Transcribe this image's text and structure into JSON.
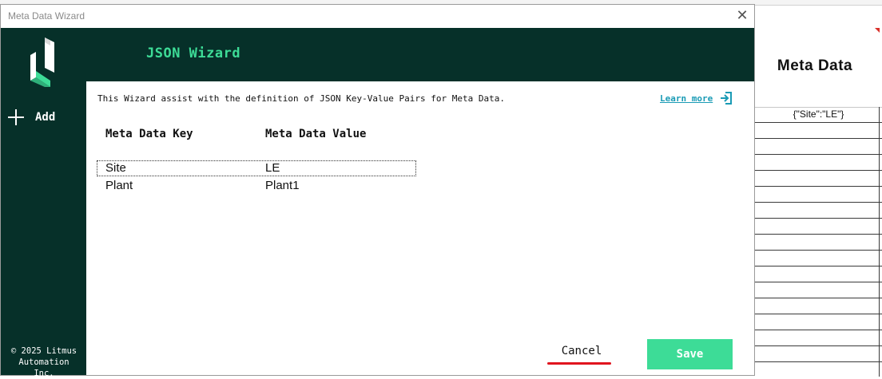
{
  "window": {
    "title": "Meta Data Wizard",
    "close_glyph": "✕"
  },
  "header": {
    "title": "JSON Wizard"
  },
  "sidebar": {
    "logo_icon": "litmus-logo-icon",
    "add_label": "Add",
    "copyright_line1": "© 2025 Litmus",
    "copyright_line2": "Automation Inc."
  },
  "content": {
    "info_text": "This Wizard assist with the definition of JSON Key-Value Pairs for Meta Data.",
    "learn_more": "Learn more",
    "columns": {
      "key": "Meta Data Key",
      "value": "Meta Data Value"
    },
    "rows": [
      {
        "key": "Site",
        "value": "LE",
        "selected": true
      },
      {
        "key": "Plant",
        "value": "Plant1",
        "selected": false
      }
    ]
  },
  "footer": {
    "cancel_label": "Cancel",
    "save_label": "Save"
  },
  "background_sheet": {
    "column_title": "Meta Data",
    "first_cell": "{\"Site\":\"LE\"}"
  },
  "colors": {
    "sidebar_bg": "#063029",
    "accent_green": "#3ddc97",
    "link_blue": "#1a9bb5",
    "annotation_red": "#e0141e"
  }
}
